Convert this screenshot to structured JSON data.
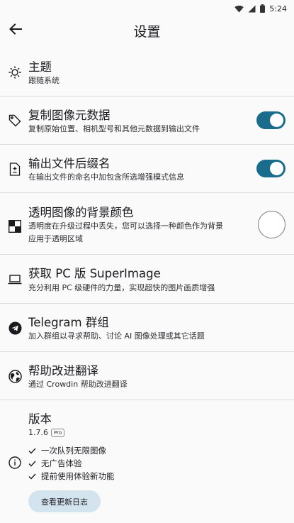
{
  "status_bar": {
    "time": "5:24"
  },
  "header": {
    "title": "设置"
  },
  "settings": {
    "theme": {
      "title": "主题",
      "subtitle": "跟随系统"
    },
    "copy_metadata": {
      "title": "复制图像元数据",
      "subtitle": "复制原始位置、相机型号和其他元数据到输出文件",
      "enabled": true
    },
    "output_suffix": {
      "title": "输出文件后缀名",
      "subtitle": "在输出文件的命名中加包含所选增强模式信息",
      "enabled": true
    },
    "transparent_bg": {
      "title": "透明图像的背景颜色",
      "subtitle_line1": "透明度在升级过程中丢失，您可以选择一种颜色作为背景",
      "subtitle_line2": "应用于透明区域",
      "color": "#ffffff"
    },
    "get_pc": {
      "title": "获取 PC 版 SuperImage",
      "subtitle": "充分利用 PC 级硬件的力量，实现超快的图片画质增强"
    },
    "telegram": {
      "title": "Telegram 群组",
      "subtitle": "加入群组以寻求帮助、讨论 AI 图像处理或其它话题"
    },
    "translate": {
      "title": "帮助改进翻译",
      "subtitle": "通过 Crowdin 帮助改进翻译"
    },
    "version": {
      "title": "版本",
      "number": "1.7.6",
      "badge": "Pro",
      "features": [
        "一次队列无限图像",
        "无广告体验",
        "提前使用体验新功能"
      ],
      "changelog_button": "查看更新日志"
    }
  },
  "colors": {
    "accent": "#1a6c8c",
    "button_bg": "#d4e4ef",
    "divider": "#dcdce0"
  }
}
